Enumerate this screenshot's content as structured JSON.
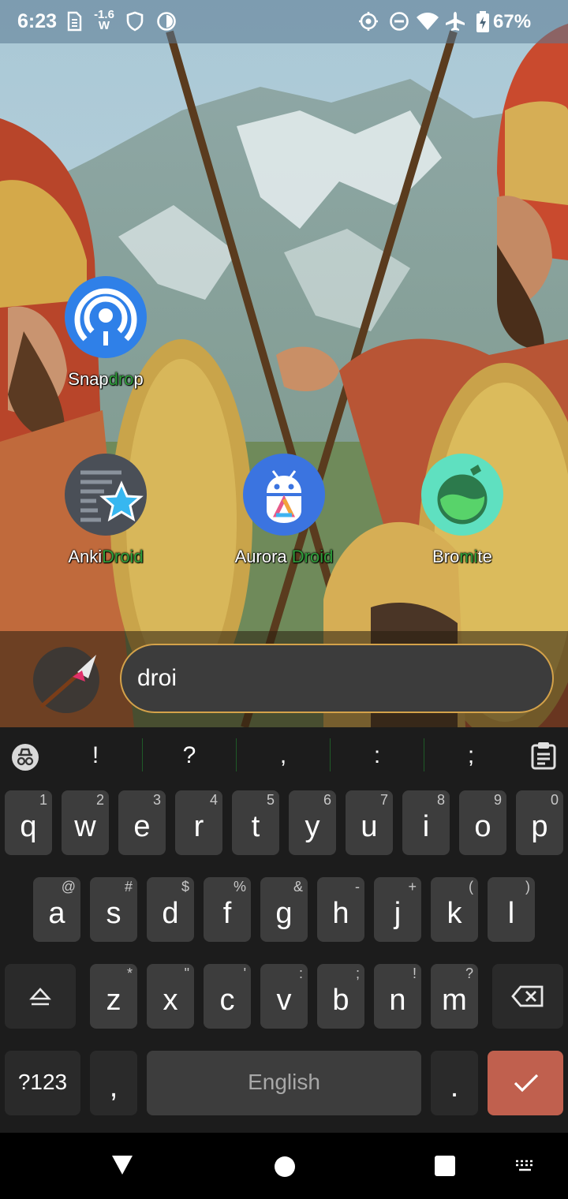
{
  "status_bar": {
    "time": "6:23",
    "power_readout_value": "-1.6",
    "power_readout_unit": "W",
    "battery": "67%",
    "icons": [
      "sim-icon",
      "shield-icon",
      "data-saver-icon",
      "location-icon",
      "dnd-icon",
      "wifi-icon",
      "airplane-icon",
      "battery-icon"
    ]
  },
  "apps": [
    {
      "name": "Snapdrop",
      "pre": "Snap",
      "match": "dro",
      "post": "p",
      "color": "#2f80e8",
      "icon": "broadcast-icon"
    },
    {
      "name": "AnkiDroid",
      "pre": "Anki",
      "match": "Droid",
      "post": "",
      "color": "#4a4f57",
      "icon": "star-icon"
    },
    {
      "name": "Aurora Droid",
      "pre": "Aurora ",
      "match": "Droid",
      "post": "",
      "color": "#3b74e0",
      "icon": "android-icon"
    },
    {
      "name": "Bromite",
      "pre": "Bro",
      "match": "mi",
      "post": "te",
      "color": "#5fe0c0",
      "icon": "flask-icon"
    }
  ],
  "search": {
    "value": "droi",
    "border_color": "#d4a24a"
  },
  "suggestions": [
    "!",
    "?",
    ",",
    ":",
    ";"
  ],
  "keyboard": {
    "row1": [
      {
        "k": "q",
        "h": "1"
      },
      {
        "k": "w",
        "h": "2"
      },
      {
        "k": "e",
        "h": "3"
      },
      {
        "k": "r",
        "h": "4"
      },
      {
        "k": "t",
        "h": "5"
      },
      {
        "k": "y",
        "h": "6"
      },
      {
        "k": "u",
        "h": "7"
      },
      {
        "k": "i",
        "h": "8"
      },
      {
        "k": "o",
        "h": "9"
      },
      {
        "k": "p",
        "h": "0"
      }
    ],
    "row2": [
      {
        "k": "a",
        "h": "@"
      },
      {
        "k": "s",
        "h": "#"
      },
      {
        "k": "d",
        "h": "$"
      },
      {
        "k": "f",
        "h": "%"
      },
      {
        "k": "g",
        "h": "&"
      },
      {
        "k": "h",
        "h": "-"
      },
      {
        "k": "j",
        "h": "+"
      },
      {
        "k": "k",
        "h": "("
      },
      {
        "k": "l",
        "h": ")"
      }
    ],
    "row3": [
      {
        "k": "z",
        "h": "*"
      },
      {
        "k": "x",
        "h": "\""
      },
      {
        "k": "c",
        "h": "'"
      },
      {
        "k": "v",
        "h": ":"
      },
      {
        "k": "b",
        "h": ";"
      },
      {
        "k": "n",
        "h": "!"
      },
      {
        "k": "m",
        "h": "?"
      }
    ],
    "symbols_label": "?123",
    "comma_label": ",",
    "space_label": "English",
    "period_label": ".",
    "enter_color": "#c0604e"
  },
  "nav_bar": {
    "icons": [
      "back-icon",
      "home-icon",
      "recents-icon",
      "keyboard-switch-icon"
    ]
  }
}
